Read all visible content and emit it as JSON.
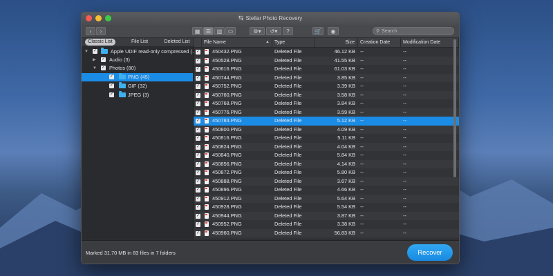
{
  "window": {
    "title": "Stellar Photo Recovery",
    "title_icon": "recover-arrow-icon"
  },
  "toolbar": {
    "back_icon": "chevron-left-icon",
    "forward_icon": "chevron-right-icon",
    "view_grid_icon": "grid-view-icon",
    "view_list_icon": "list-view-icon",
    "view_column_icon": "column-view-icon",
    "view_cover_icon": "coverflow-view-icon",
    "settings_icon": "gear-icon",
    "history_icon": "history-icon",
    "help_label": "?",
    "cart_icon": "cart-icon",
    "account_icon": "user-icon",
    "search_placeholder": "Search"
  },
  "tabs": [
    "Classic List",
    "File List",
    "Deleted List"
  ],
  "tree": [
    {
      "label": "Apple UDIF read-only compressed (…",
      "level": 0,
      "expanded": true,
      "checked": true,
      "selected": false
    },
    {
      "label": "Audio (3)",
      "level": 1,
      "expanded": false,
      "checked": true,
      "selected": false
    },
    {
      "label": "Photos (80)",
      "level": 1,
      "expanded": true,
      "checked": true,
      "selected": false
    },
    {
      "label": "PNG (45)",
      "level": 2,
      "checked": true,
      "selected": true
    },
    {
      "label": "GIF (32)",
      "level": 2,
      "checked": true,
      "selected": false
    },
    {
      "label": "JPEG (3)",
      "level": 2,
      "checked": true,
      "selected": false
    }
  ],
  "columns": [
    "File Name",
    "Type",
    "Size",
    "Creation Date",
    "Modification Date"
  ],
  "files": [
    {
      "name": "450432.PNG",
      "type": "Deleted File",
      "size": "46.12 KB",
      "created": "--",
      "modified": "--"
    },
    {
      "name": "450528.PNG",
      "type": "Deleted File",
      "size": "41.55 KB",
      "created": "--",
      "modified": "--"
    },
    {
      "name": "450616.PNG",
      "type": "Deleted File",
      "size": "61.03 KB",
      "created": "--",
      "modified": "--"
    },
    {
      "name": "450744.PNG",
      "type": "Deleted File",
      "size": "3.85 KB",
      "created": "--",
      "modified": "--"
    },
    {
      "name": "450752.PNG",
      "type": "Deleted File",
      "size": "3.39 KB",
      "created": "--",
      "modified": "--"
    },
    {
      "name": "450760.PNG",
      "type": "Deleted File",
      "size": "3.58 KB",
      "created": "--",
      "modified": "--"
    },
    {
      "name": "450768.PNG",
      "type": "Deleted File",
      "size": "3.84 KB",
      "created": "--",
      "modified": "--"
    },
    {
      "name": "450776.PNG",
      "type": "Deleted File",
      "size": "3.59 KB",
      "created": "--",
      "modified": "--"
    },
    {
      "name": "450784.PNG",
      "type": "Deleted File",
      "size": "5.12 KB",
      "created": "--",
      "modified": "--",
      "selected": true
    },
    {
      "name": "450800.PNG",
      "type": "Deleted File",
      "size": "4.09 KB",
      "created": "--",
      "modified": "--"
    },
    {
      "name": "450816.PNG",
      "type": "Deleted File",
      "size": "5.11 KB",
      "created": "--",
      "modified": "--"
    },
    {
      "name": "450824.PNG",
      "type": "Deleted File",
      "size": "4.04 KB",
      "created": "--",
      "modified": "--"
    },
    {
      "name": "450840.PNG",
      "type": "Deleted File",
      "size": "5.84 KB",
      "created": "--",
      "modified": "--"
    },
    {
      "name": "450856.PNG",
      "type": "Deleted File",
      "size": "4.14 KB",
      "created": "--",
      "modified": "--"
    },
    {
      "name": "450872.PNG",
      "type": "Deleted File",
      "size": "5.80 KB",
      "created": "--",
      "modified": "--"
    },
    {
      "name": "450888.PNG",
      "type": "Deleted File",
      "size": "3.67 KB",
      "created": "--",
      "modified": "--"
    },
    {
      "name": "450896.PNG",
      "type": "Deleted File",
      "size": "4.66 KB",
      "created": "--",
      "modified": "--"
    },
    {
      "name": "450912.PNG",
      "type": "Deleted File",
      "size": "5.64 KB",
      "created": "--",
      "modified": "--"
    },
    {
      "name": "450928.PNG",
      "type": "Deleted File",
      "size": "5.54 KB",
      "created": "--",
      "modified": "--"
    },
    {
      "name": "450944.PNG",
      "type": "Deleted File",
      "size": "3.87 KB",
      "created": "--",
      "modified": "--"
    },
    {
      "name": "450952.PNG",
      "type": "Deleted File",
      "size": "3.38 KB",
      "created": "--",
      "modified": "--"
    },
    {
      "name": "450960.PNG",
      "type": "Deleted File",
      "size": "56.83 KB",
      "created": "--",
      "modified": "--"
    }
  ],
  "footer": {
    "status": "Marked 31.70 MB in 83 files in 7 folders",
    "recover_label": "Recover"
  },
  "colors": {
    "accent": "#1b8ce6",
    "recover": "#1f95e8",
    "window_bg": "#2c2d30"
  }
}
